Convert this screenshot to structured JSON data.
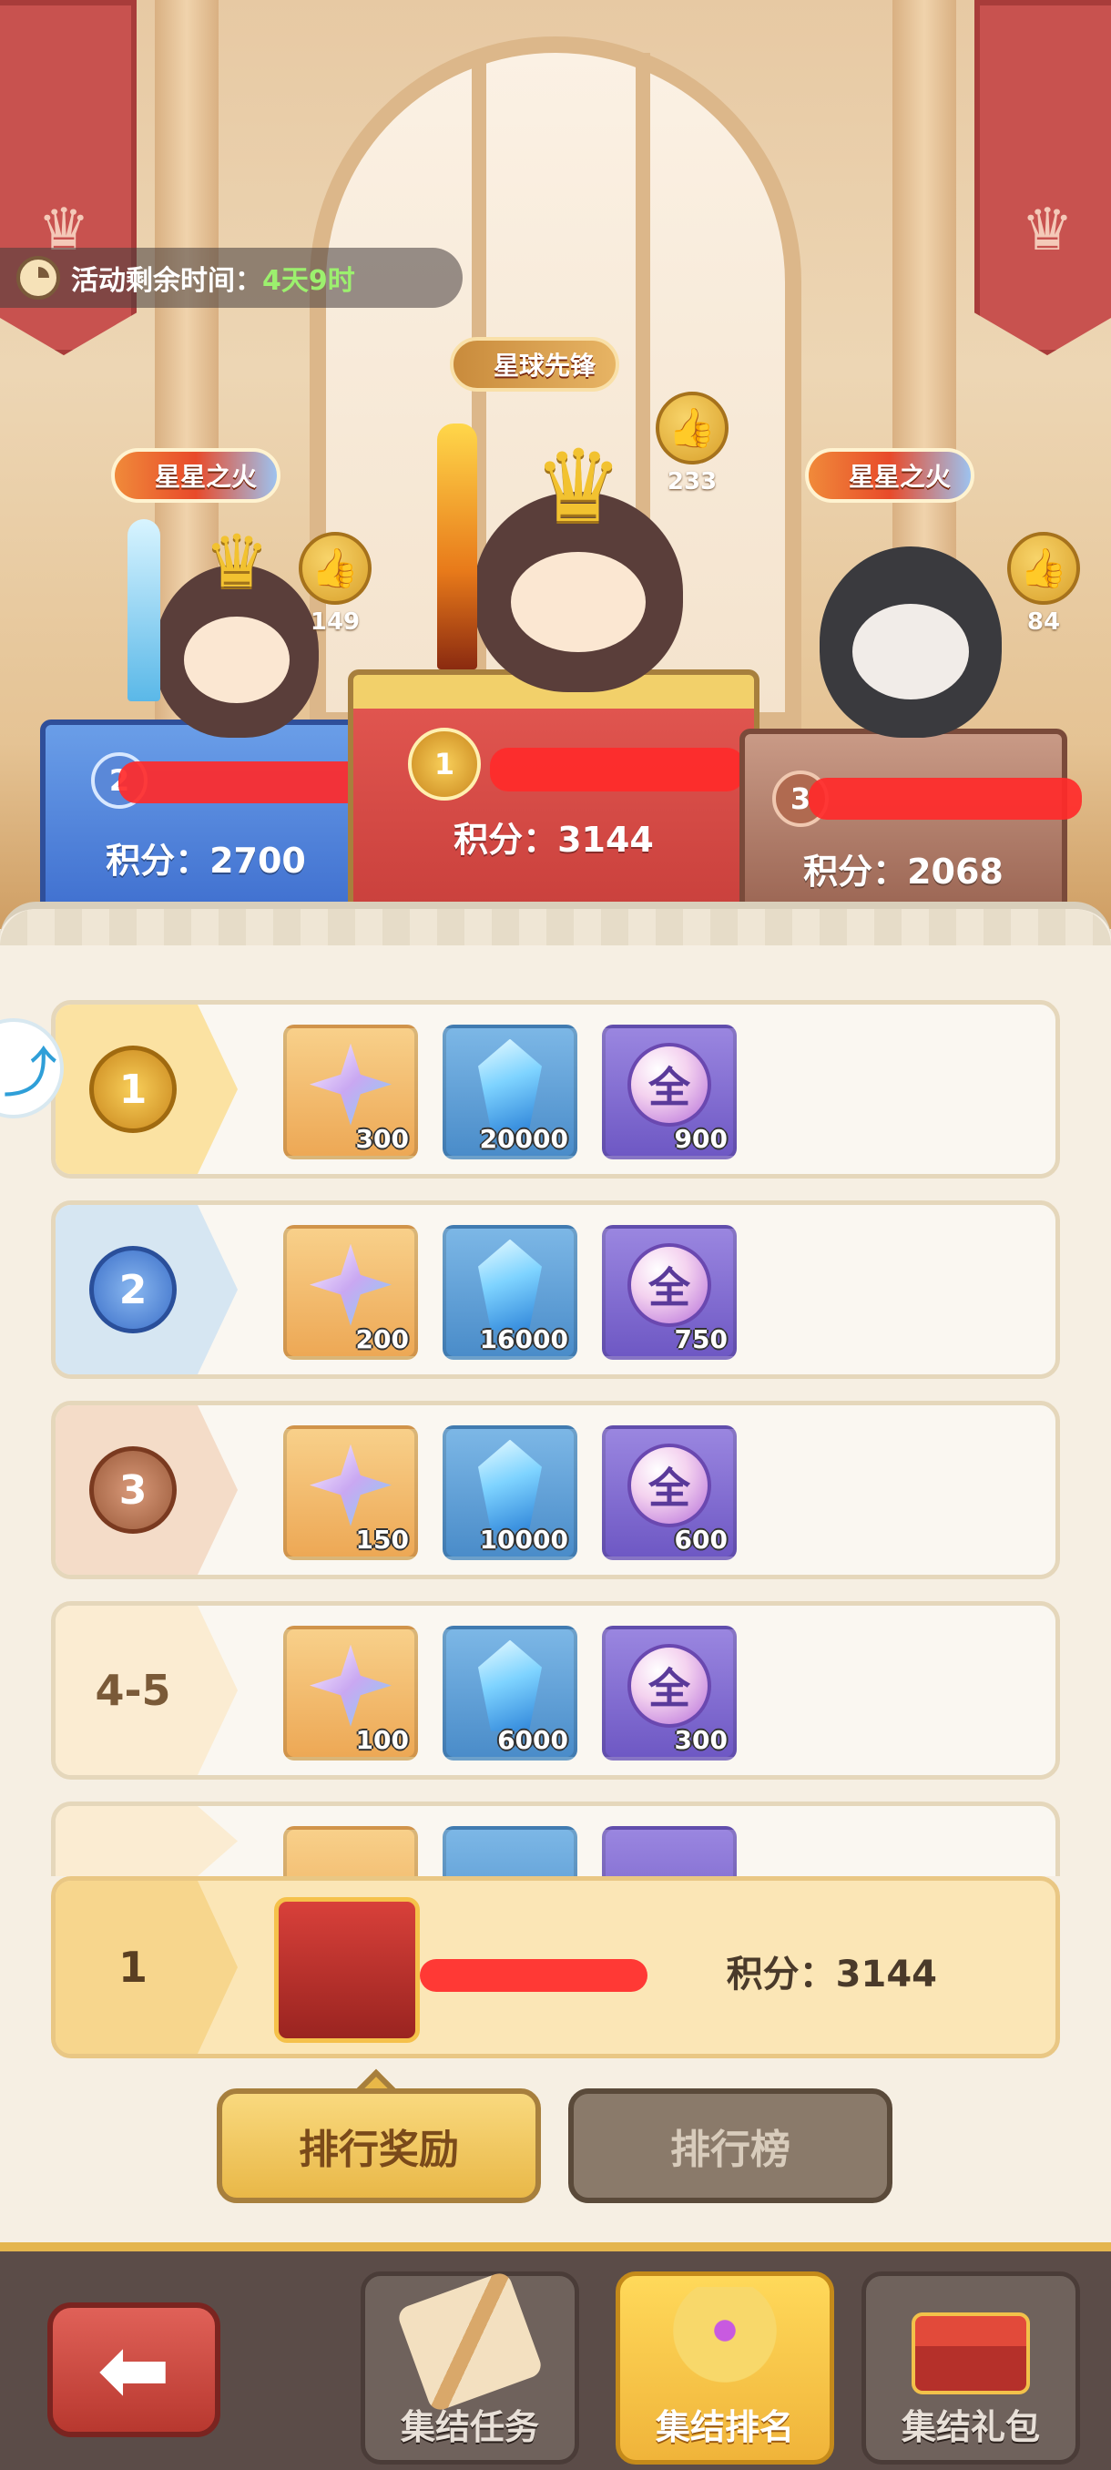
{
  "timer": {
    "label": "活动剩余时间：",
    "value": "4天9时"
  },
  "podium": {
    "first": {
      "title": "星球先锋",
      "likes": "233",
      "score": "积分：3144",
      "rank": "1"
    },
    "second": {
      "title": "星星之火",
      "likes": "149",
      "score": "积分：2700",
      "rank": "2"
    },
    "third": {
      "title": "星星之火",
      "likes": "84",
      "score": "积分：2068",
      "rank": "3"
    }
  },
  "icons": {
    "thumb": "👍",
    "back": "⬅",
    "crown": "♛",
    "share": "⤴"
  },
  "rewards": [
    {
      "rank": "1",
      "items": [
        {
          "type": "star",
          "qty": "300"
        },
        {
          "type": "gem",
          "qty": "20000"
        },
        {
          "type": "all",
          "glyph": "全",
          "qty": "900"
        }
      ]
    },
    {
      "rank": "2",
      "items": [
        {
          "type": "star",
          "qty": "200"
        },
        {
          "type": "gem",
          "qty": "16000"
        },
        {
          "type": "all",
          "glyph": "全",
          "qty": "750"
        }
      ]
    },
    {
      "rank": "3",
      "items": [
        {
          "type": "star",
          "qty": "150"
        },
        {
          "type": "gem",
          "qty": "10000"
        },
        {
          "type": "all",
          "glyph": "全",
          "qty": "600"
        }
      ]
    },
    {
      "rank": "4-5",
      "items": [
        {
          "type": "star",
          "qty": "100"
        },
        {
          "type": "gem",
          "qty": "6000"
        },
        {
          "type": "all",
          "glyph": "全",
          "qty": "300"
        }
      ]
    }
  ],
  "my_rank": {
    "rank": "1",
    "score": "积分：3144"
  },
  "tabs": {
    "rewards": "排行奖励",
    "leaderboard": "排行榜"
  },
  "nav": {
    "task": "集结任务",
    "ranking": "集结排名",
    "gift": "集结礼包"
  },
  "colors": {
    "accent": "#e9b848",
    "podium_gold": "#d94c4a",
    "podium_blue": "#4a7ed8",
    "podium_bronze": "#b27a62",
    "timer_green": "#9cf06e"
  }
}
